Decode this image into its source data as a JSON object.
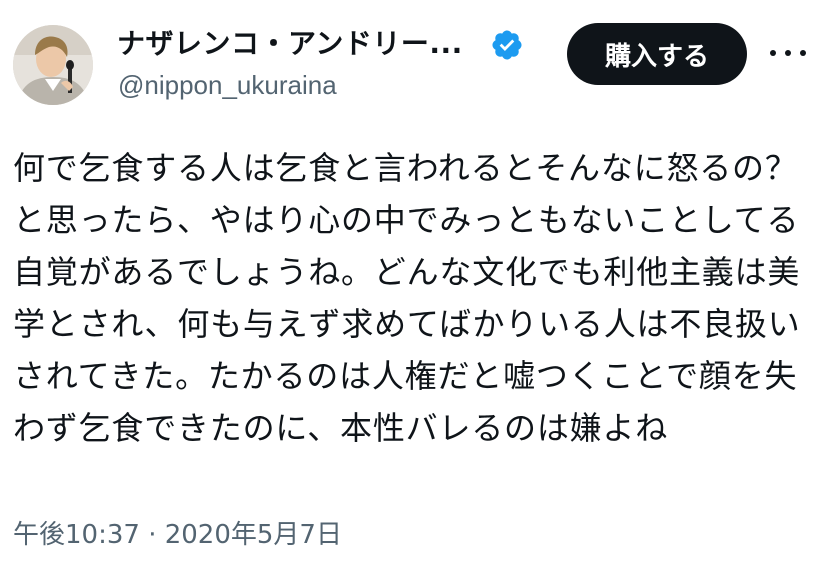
{
  "author": {
    "display_name": "ナザレンコ・アンドリー...",
    "handle": "@nippon_ukuraina",
    "verified": true
  },
  "actions": {
    "buy_label": "購入する"
  },
  "tweet": {
    "text": "何で乞食する人は乞食と言われるとそんなに怒るの？と思ったら、やはり心の中でみっともないことしてる自覚があるでしょうね。どんな文化でも利他主義は美学とされ、何も与えず求めてばかりいる人は不良扱いされてきた。たかるのは人権だと嘘つくことで顔を失わず乞食できたのに、本性バレるのは嫌よね",
    "timestamp": "午後10:37 · 2020年5月7日"
  },
  "colors": {
    "text_primary": "#0f1419",
    "text_secondary": "#536471",
    "verified_badge": "#1d9bf0",
    "button_bg": "#0f1419",
    "button_text": "#ffffff"
  },
  "icons": {
    "verified": "verified-badge-icon",
    "more": "more-dots-icon"
  }
}
